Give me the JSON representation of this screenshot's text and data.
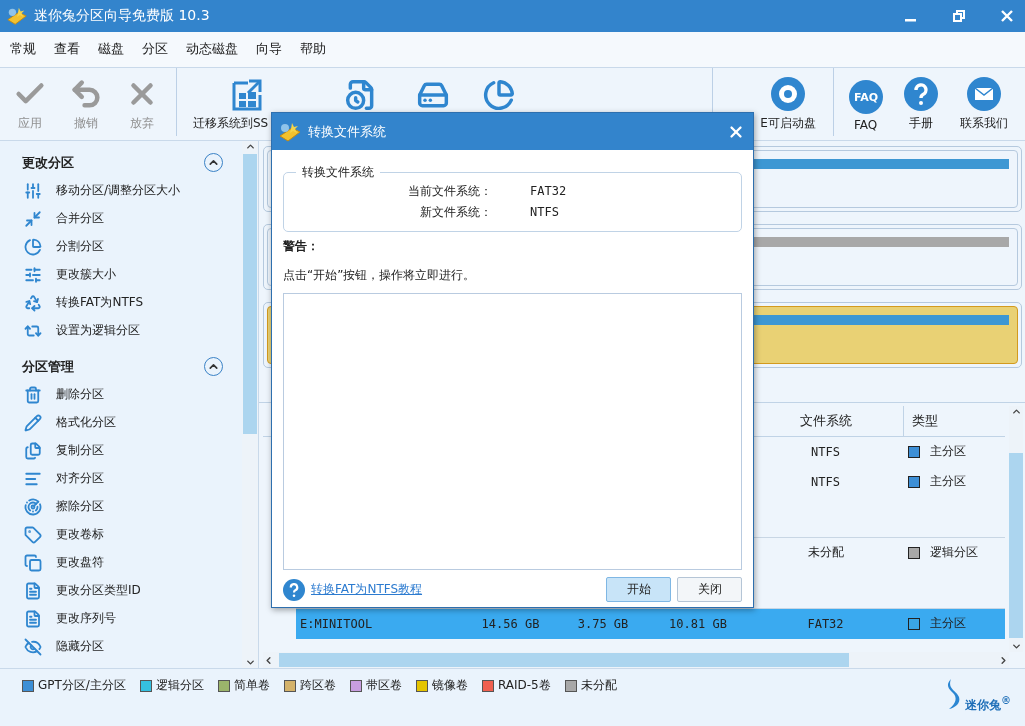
{
  "window": {
    "title": "迷你兔分区向导免费版 10.3"
  },
  "menu": [
    "常规",
    "查看",
    "磁盘",
    "分区",
    "动态磁盘",
    "向导",
    "帮助"
  ],
  "toolbar": {
    "edit": [
      {
        "label": "应用",
        "disabled": true
      },
      {
        "label": "撤销",
        "disabled": true
      },
      {
        "label": "放弃",
        "disabled": true
      }
    ],
    "tools": [
      {
        "label": "迁移系统到SS",
        "disabled": false
      }
    ],
    "media": [
      {
        "label": "E可启动盘",
        "disabled": false
      }
    ],
    "help": [
      {
        "label": "FAQ",
        "badge": "FAQ",
        "disabled": false
      },
      {
        "label": "手册",
        "disabled": false
      },
      {
        "label": "联系我们",
        "disabled": false
      }
    ]
  },
  "sidebar": {
    "sections": [
      {
        "title": "更改分区",
        "expanded": true,
        "items": [
          "移动分区/调整分区大小",
          "合并分区",
          "分割分区",
          "更改簇大小",
          "转换FAT为NTFS",
          "设置为逻辑分区"
        ]
      },
      {
        "title": "分区管理",
        "expanded": true,
        "items": [
          "删除分区",
          "格式化分区",
          "复制分区",
          "对齐分区",
          "擦除分区",
          "更改卷标",
          "更改盘符",
          "更改分区类型ID",
          "更改序列号",
          "隐藏分区"
        ]
      }
    ]
  },
  "disk_map": [
    {
      "selected": false,
      "color": "#3d97d3"
    },
    {
      "selected": false,
      "color": "#a8a8a8"
    },
    {
      "selected": true,
      "color": "#3d97d3"
    }
  ],
  "table": {
    "columns": [
      {
        "label": "文件系统"
      },
      {
        "label": "类型"
      }
    ],
    "groups": [
      {
        "rows": [
          {
            "file_system": "NTFS",
            "type": "主分区",
            "color": "#3d8fd6",
            "selected": false
          },
          {
            "file_system": "NTFS",
            "type": "主分区",
            "color": "#3d8fd6",
            "selected": false
          }
        ]
      },
      {
        "rows": [
          {
            "file_system": "未分配",
            "type": "逻辑分区",
            "color": "#a8a8a8",
            "selected": false
          }
        ]
      },
      {
        "rows": [
          {
            "partition": "E:MINITOOL",
            "capacity": "14.56 GB",
            "used": "3.75 GB",
            "unused": "10.81 GB",
            "file_system": "FAT32",
            "type": "主分区",
            "color": "#3aa6e6",
            "selected": true
          }
        ]
      }
    ]
  },
  "legend": [
    {
      "label": "GPT分区/主分区",
      "color": "#3d8fd6"
    },
    {
      "label": "逻辑分区",
      "color": "#35c0e0"
    },
    {
      "label": "简单卷",
      "color": "#9bb46b"
    },
    {
      "label": "跨区卷",
      "color": "#d4b26a"
    },
    {
      "label": "带区卷",
      "color": "#c89ee0"
    },
    {
      "label": "镜像卷",
      "color": "#e5c400"
    },
    {
      "label": "RAID-5卷",
      "color": "#f06050"
    },
    {
      "label": "未分配",
      "color": "#a8a8a8"
    }
  ],
  "logo": {
    "text": "迷你兔$^{®}$"
  },
  "dialog": {
    "title": "转换文件系统",
    "group_title": "转换文件系统",
    "fields": [
      {
        "label": "当前文件系统：",
        "value": "FAT32"
      },
      {
        "label": "新文件系统：",
        "value": "NTFS"
      }
    ],
    "warning_title": "警告：",
    "message": "点击“开始”按钮，操作将立即进行。",
    "help_link": "转换FAT为NTFS教程",
    "buttons": [
      {
        "label": "开始",
        "focused": true
      },
      {
        "label": "关闭",
        "focused": false
      }
    ]
  }
}
